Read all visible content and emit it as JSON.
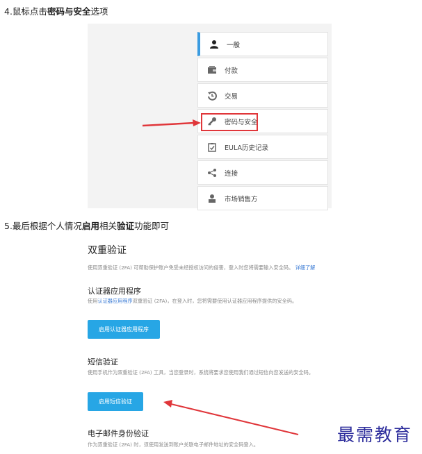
{
  "step4": {
    "prefix": "4.鼠标点击",
    "bold": "密码与安全",
    "suffix": "选项"
  },
  "menu": {
    "items": [
      {
        "label": "一般",
        "icon": "user-icon",
        "active": true
      },
      {
        "label": "付款",
        "icon": "wallet-icon",
        "active": false
      },
      {
        "label": "交易",
        "icon": "history-icon",
        "active": false
      },
      {
        "label": "密码与安全",
        "icon": "key-icon",
        "active": false,
        "highlighted": true
      },
      {
        "label": "EULA历史记录",
        "icon": "clipboard-check-icon",
        "active": false
      },
      {
        "label": "连接",
        "icon": "share-icon",
        "active": false
      },
      {
        "label": "市场销售方",
        "icon": "person-bust-icon",
        "active": false
      }
    ]
  },
  "step5": {
    "prefix": "5.最后根据个人情况",
    "bold1": "启用",
    "mid": "相关",
    "bold2": "验证",
    "suffix": "功能即可"
  },
  "twofa": {
    "title": "双重验证",
    "intro": "使用双重验证 (2FA) 可帮助保护账户免受未经授权访问的侵害，登入时您将需要输入安全码。",
    "intro_link": "详细了解",
    "auth_app": {
      "heading": "认证器应用程序",
      "desc_prefix": "使用",
      "desc_link": "认证器应用程序",
      "desc_suffix": "双重验证 (2FA)，在登入时，您将需要使用认证器应用程序提供的安全码。",
      "button": "启用认证器应用程序"
    },
    "sms": {
      "heading": "短信验证",
      "desc": "使用手机作为双重验证 (2FA) 工具，当您登录时，系统将要求您使用我们通过短信向您发送的安全码。",
      "button": "启用短信验证"
    },
    "email": {
      "heading": "电子邮件身份验证",
      "desc": "作为双重验证 (2FA) 时，须使用发送到账户关联电子邮件地址的安全码登入。"
    }
  },
  "watermark": "最需教育",
  "colors": {
    "accent": "#27a6e5",
    "highlight": "#e0363a",
    "active_bar": "#3a9be0",
    "watermark": "#2d2d9c"
  }
}
